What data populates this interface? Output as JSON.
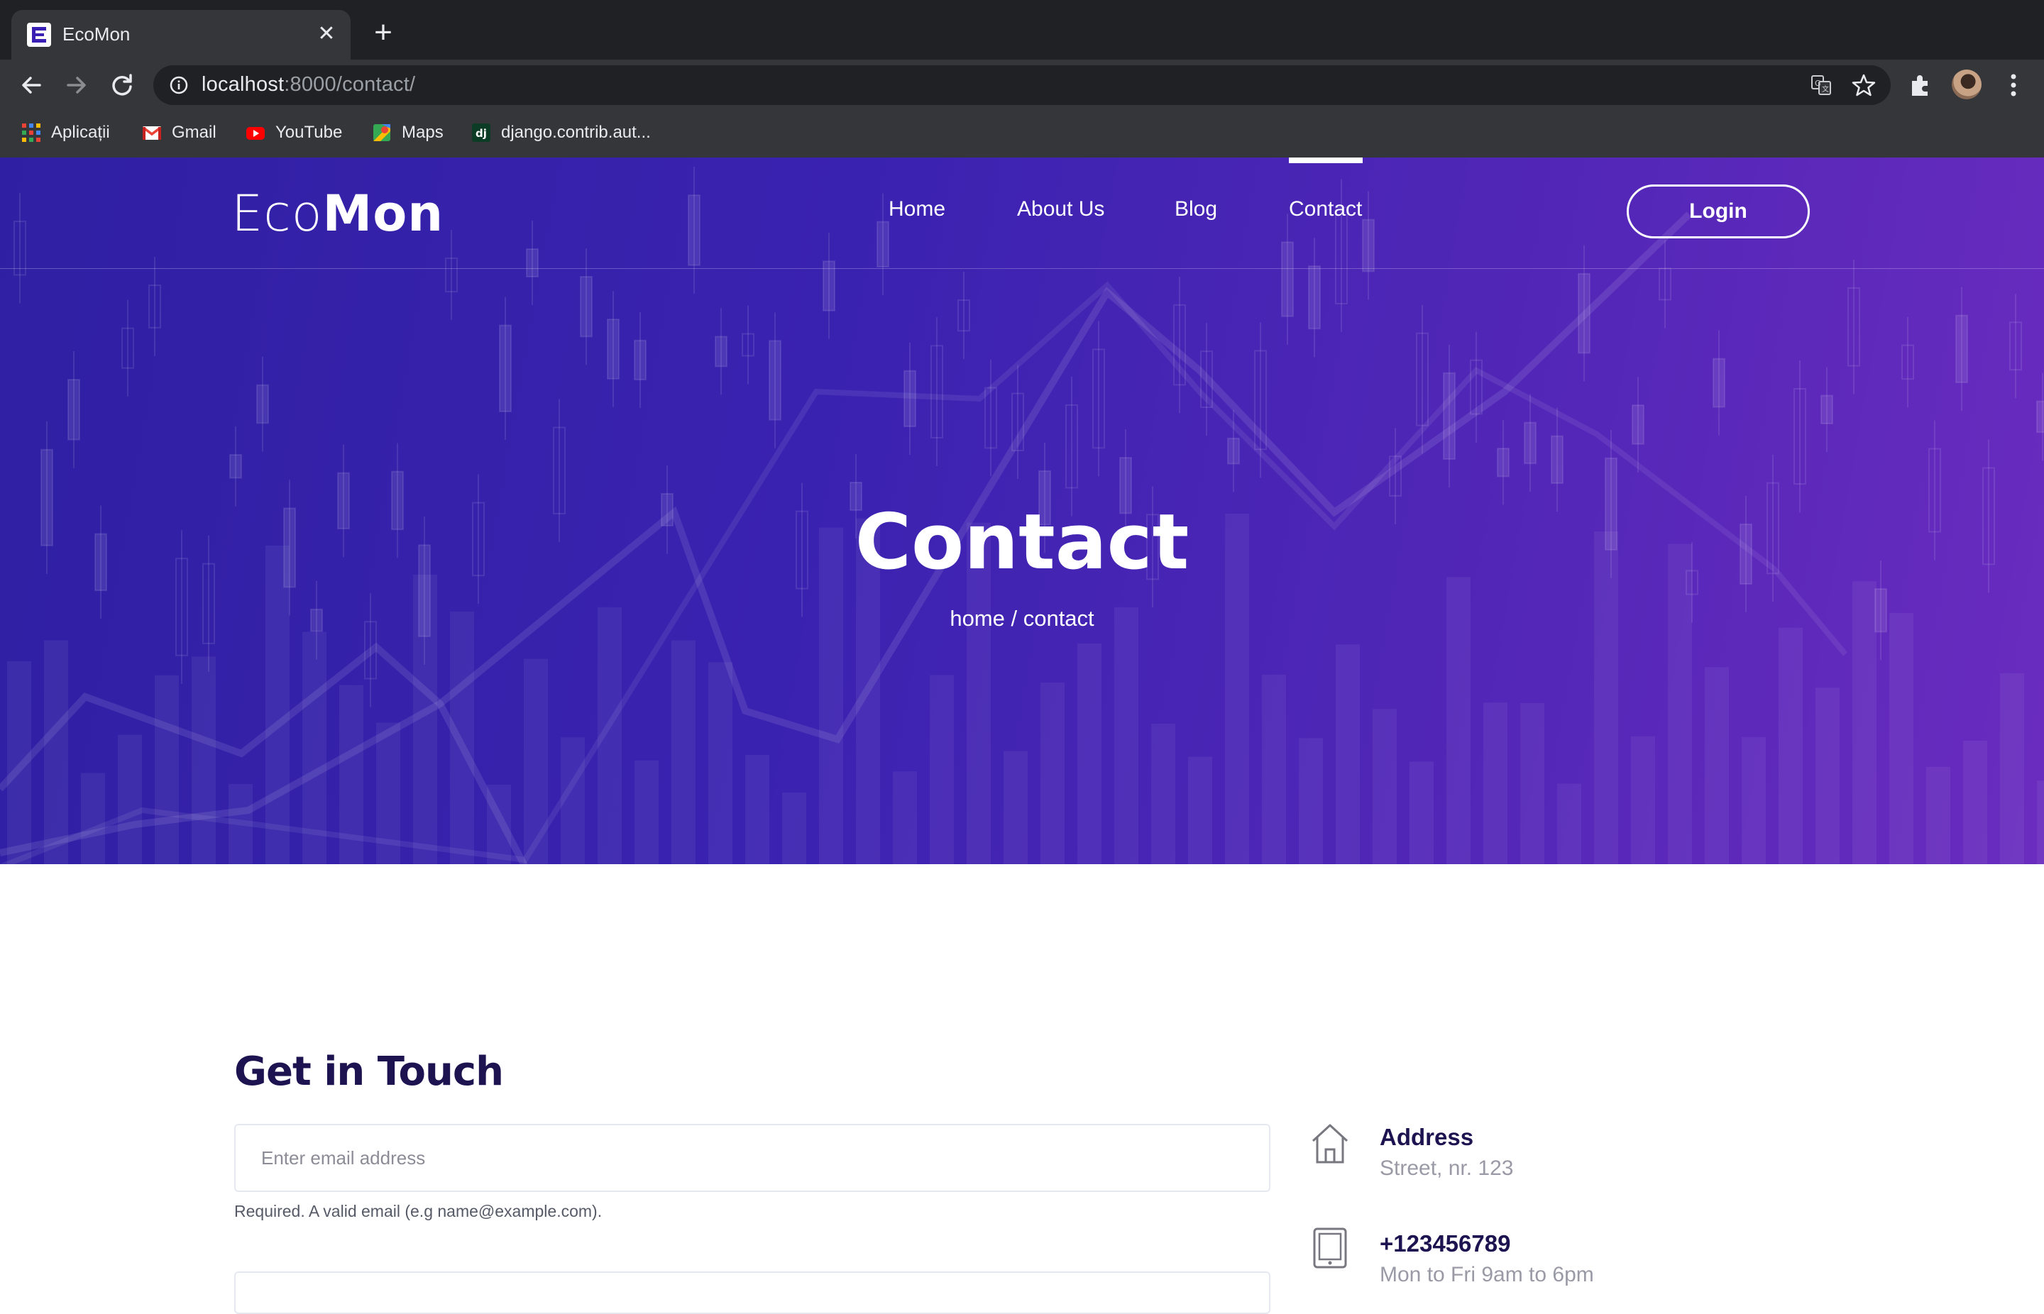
{
  "browser": {
    "tab_title": "EcoMon",
    "url_host": "localhost",
    "url_rest": ":8000/contact/",
    "bookmarks": [
      {
        "label": "Aplicații",
        "icon": "apps-grid-icon"
      },
      {
        "label": "Gmail",
        "icon": "gmail-icon"
      },
      {
        "label": "YouTube",
        "icon": "youtube-icon"
      },
      {
        "label": "Maps",
        "icon": "maps-icon"
      },
      {
        "label": "django.contrib.aut...",
        "icon": "django-icon"
      }
    ]
  },
  "site": {
    "logo_light": "Eco",
    "logo_bold": "Mon",
    "nav": [
      {
        "label": "Home"
      },
      {
        "label": "About Us"
      },
      {
        "label": "Blog"
      },
      {
        "label": "Contact",
        "active": true
      }
    ],
    "login_label": "Login"
  },
  "hero": {
    "title": "Contact",
    "breadcrumb": "home / contact"
  },
  "contact": {
    "heading": "Get in Touch",
    "email_placeholder": "Enter email address",
    "email_help": "Required. A valid email (e.g name@example.com).",
    "info": [
      {
        "title": "Address",
        "subtitle": "Street, nr. 123",
        "icon": "home-icon"
      },
      {
        "title": "+123456789",
        "subtitle": "Mon to Fri 9am to 6pm",
        "icon": "tablet-icon"
      }
    ]
  },
  "colors": {
    "hero_start": "#2f20a3",
    "hero_end": "#6a2cbf",
    "heading": "#1d1350"
  }
}
